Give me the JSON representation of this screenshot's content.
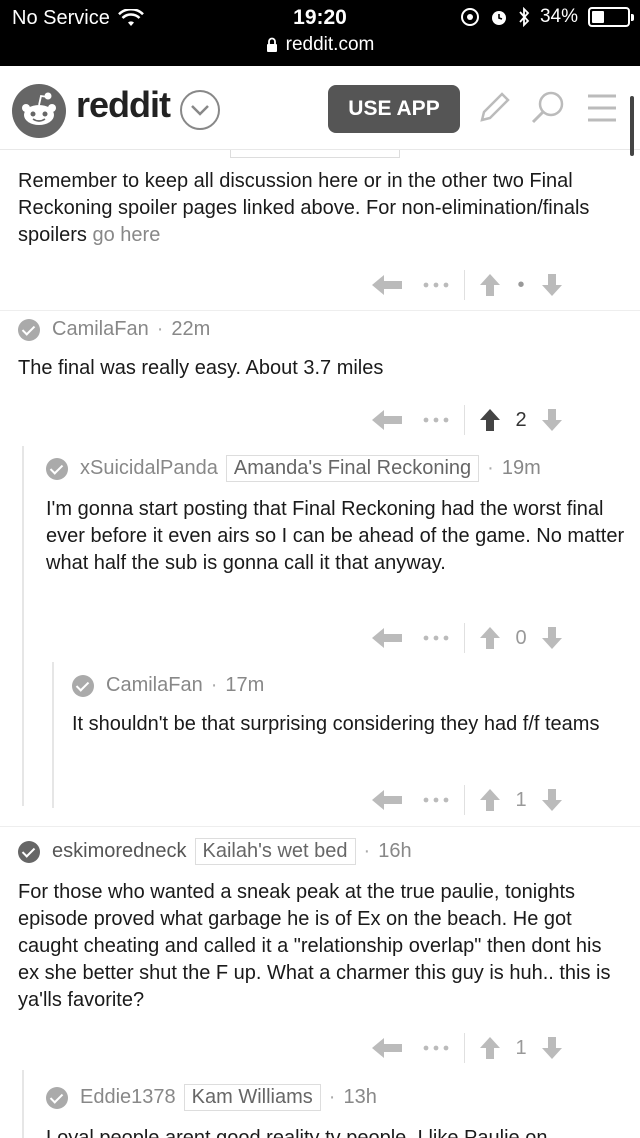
{
  "status_bar": {
    "carrier": "No Service",
    "time": "19:20",
    "url": "reddit.com",
    "battery": "34%",
    "battery_level": 0.34
  },
  "header": {
    "brand": "reddit",
    "use_app_label": "USE APP"
  },
  "comments": [
    {
      "body": "Remember to keep all discussion here or in the other two Final Reckoning spoiler pages linked above. For non-elimination/finals spoilers ",
      "link_text": "go here",
      "score": "•"
    },
    {
      "author": "CamilaFan",
      "time": "22m",
      "body": "The final was really easy. About 3.7 miles",
      "score": "2"
    },
    {
      "author": "xSuicidalPanda",
      "flair": "Amanda's Final Reckoning",
      "time": "19m",
      "body": "I'm gonna start posting that Final Reckoning had the worst final ever before it even airs so I can be ahead of the game. No matter what half the sub is gonna call it that anyway.",
      "score": "0"
    },
    {
      "author": "CamilaFan",
      "time": "17m",
      "body": "It shouldn't be that surprising considering they had f/f teams",
      "score": "1"
    },
    {
      "author": "eskimoredneck",
      "flair": "Kailah's wet bed",
      "time": "16h",
      "body": "For those who wanted a sneak peak at the true paulie, tonights episode proved what garbage he is of Ex on the beach. He got caught cheating and called it a \"relationship overlap\" then dont his ex she better shut the F up. What a charmer this guy is huh.. this is ya'lls favorite?",
      "score": "1"
    },
    {
      "author": "Eddie1378",
      "flair": "Kam Williams",
      "time": "13h",
      "body": "Loyal people arent good reality tv people. I like Paulie on"
    }
  ],
  "icons": {
    "wifi": "wifi-icon",
    "lock": "lock-icon",
    "reply": "reply-arrow-icon",
    "more": "more-dots-icon",
    "upvote": "upvote-arrow-icon",
    "downvote": "downvote-arrow-icon",
    "search": "search-icon",
    "pencil": "pencil-icon",
    "menu": "hamburger-menu-icon"
  }
}
